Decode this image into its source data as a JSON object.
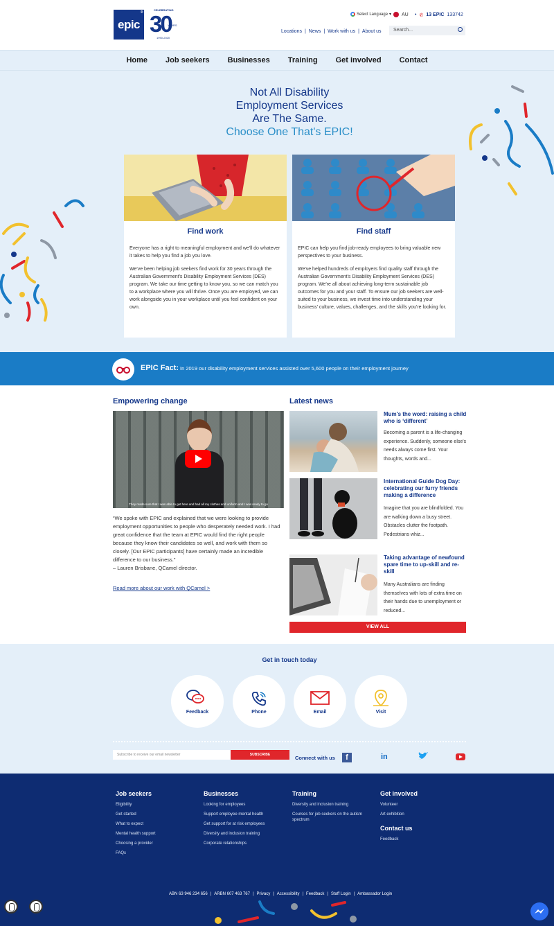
{
  "header": {
    "logo": "epic",
    "anniversary": {
      "small": "CELEBRATING",
      "big": "30",
      "years": "YEARS",
      "range": "1990-2020"
    },
    "language": "Select Language",
    "country": "AU",
    "phone_label": "13 EPIC",
    "phone_number": "133742",
    "links": [
      "Locations",
      "News",
      "Work with us",
      "About us"
    ],
    "search_placeholder": "Search..."
  },
  "nav": [
    "Home",
    "Job seekers",
    "Businesses",
    "Training",
    "Get involved",
    "Contact"
  ],
  "hero": {
    "title_lines": [
      "Not All Disability",
      "Employment Services",
      "Are The Same."
    ],
    "accent": "Choose One That's EPIC!"
  },
  "cards": [
    {
      "title": "Find work",
      "p1": "Everyone has a right to meaningful employment and we'll do whatever it takes to help you find a job you love.",
      "p2": "We've been helping job seekers find work for 30 years through the Australian Government's Disability Employment Services (DES) program. We take our time getting to know you, so we can match you to a workplace where you will thrive. Once you are employed, we can work alongside you in your workplace until you feel confident on your own."
    },
    {
      "title": "Find staff",
      "p1": "EPIC can help you find job-ready employees to bring valuable new perspectives to your business.",
      "p2": "We've helped hundreds of employers find quality staff through the Australian Government's Disability Employment Services (DES) program. We're all about achieving long-term sustainable job outcomes for you and your staff. To ensure our job seekers are well-suited to your business, we invest time into understanding your business' culture, values, challenges, and the skills you're looking for."
    }
  ],
  "fact": {
    "label": "EPIC Fact:",
    "text": "In 2019 our disability employment services assisted over 5,600 people on their employment journey"
  },
  "empowering": {
    "heading": "Empowering change",
    "video_caption": "They made sure that I was able to get here and had all my clothes and uniform and I was ready to go",
    "quote": "“We spoke with EPIC and explained that we were looking to provide employment opportunities to people who desperately needed work. I had great confidence that the team at EPIC would find the right people because they know their candidates so well, and work with them so closely. [Our EPIC participants] have certainly made an incredible difference to our business.”",
    "author": "– Lauren Brisbane, QCamel director.",
    "read_more": "Read more about our work with QCamel >"
  },
  "news": {
    "heading": "Latest news",
    "items": [
      {
        "title": "Mum's the word: raising a child who is ‘different’",
        "excerpt": "Becoming a parent is a life-changing experience. Suddenly, someone else's needs always come first. Your thoughts, words and..."
      },
      {
        "title": "International Guide Dog Day: celebrating our furry friends making a difference",
        "excerpt": "Imagine that you are blindfolded. You are walking down a busy street. Obstacles clutter the footpath. Pedestrians whiz..."
      },
      {
        "title": "Taking advantage of newfound spare time to up-skill and re-skill",
        "excerpt": "Many Australians are finding themselves with lots of extra time on their hands due to unemployment or reduced..."
      }
    ],
    "view_all": "VIEW ALL"
  },
  "contact": {
    "heading": "Get in touch today",
    "buttons": [
      "Feedback",
      "Phone",
      "Email",
      "Visit"
    ],
    "newsletter_placeholder": "Subscribe to receive our email newsletter",
    "subscribe": "SUBSCRIBE",
    "connect": "Connect with us"
  },
  "footer": {
    "cols": [
      {
        "title": "Job seekers",
        "links": [
          "Eligibility",
          "Get started",
          "What to expect",
          "Mental health support",
          "Choosing a provider",
          "FAQs"
        ]
      },
      {
        "title": "Businesses",
        "links": [
          "Looking for employees",
          "Support employee mental health",
          "Get support for at risk employees",
          "Diversity and inclusion training",
          "Corporate relationships"
        ]
      },
      {
        "title": "Training",
        "links": [
          "Diversity and inclusion training",
          "Courses for job seekers on the autism spectrum"
        ]
      },
      {
        "title": "Get involved",
        "links": [
          "Volunteer",
          "Art exhibition"
        ]
      },
      {
        "title": "Contact us",
        "links": [
          "Feedback"
        ]
      }
    ],
    "bottom": [
      "ABN 63 946 234 656",
      "ARBN 607 463 767",
      "Privacy",
      "Accessibility",
      "Feedback",
      "Staff Login",
      "Ambassador Login"
    ]
  }
}
